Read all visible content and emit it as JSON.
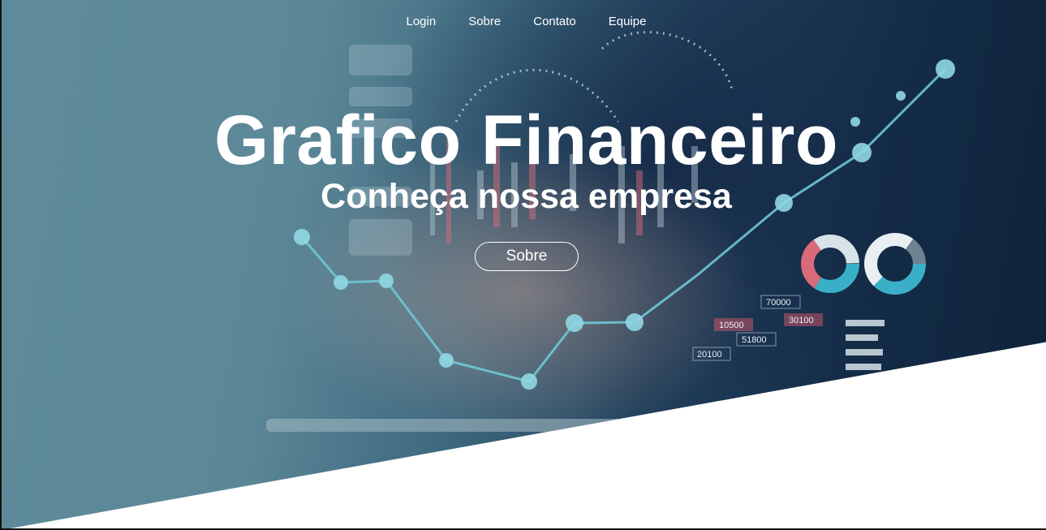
{
  "nav": {
    "items": [
      {
        "label": "Login"
      },
      {
        "label": "Sobre"
      },
      {
        "label": "Contato"
      },
      {
        "label": "Equipe"
      }
    ]
  },
  "hero": {
    "title": "Grafico Financeiro",
    "subtitle": "Conheça nossa empresa",
    "button_label": "Sobre",
    "chart_numbers": [
      "70000",
      "30100",
      "10500",
      "51800",
      "20100"
    ]
  },
  "colors": {
    "overlay_teal": "#5e8b9b",
    "overlay_navy": "#142c47",
    "text": "#ffffff",
    "bottom_background": "#ffffff"
  }
}
